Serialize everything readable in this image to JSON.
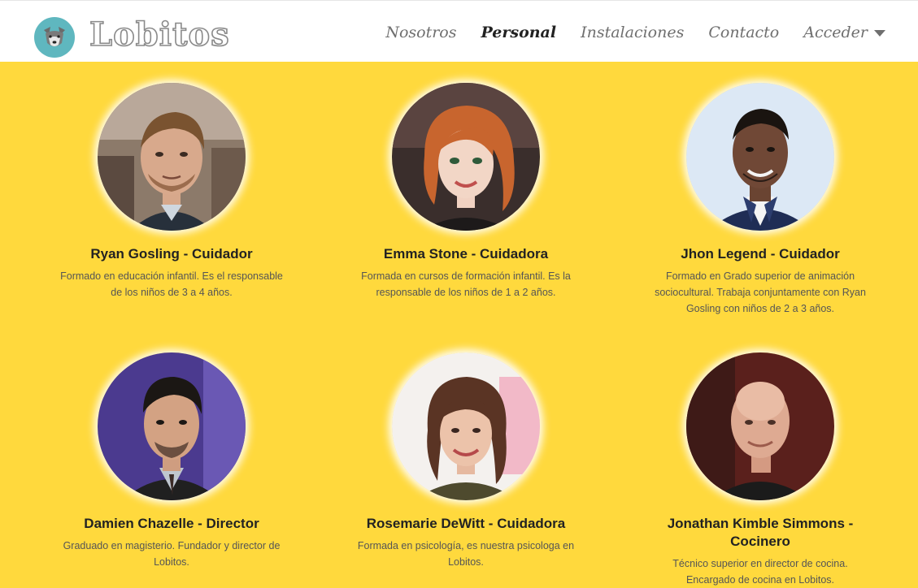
{
  "brand": {
    "name": "Lobitos",
    "logo_icon": "wolf-icon"
  },
  "nav": {
    "items": [
      {
        "label": "Nosotros",
        "active": false
      },
      {
        "label": "Personal",
        "active": true
      },
      {
        "label": "Instalaciones",
        "active": false
      },
      {
        "label": "Contacto",
        "active": false
      },
      {
        "label": "Acceder",
        "active": false,
        "dropdown": true
      }
    ]
  },
  "colors": {
    "background": "#ffd93d",
    "navbar": "#ffffff",
    "logo_circle": "#5fb7bf"
  },
  "staff": [
    {
      "name": "Ryan Gosling - Cuidador",
      "description": "Formado en educación infantil. Es el responsable de los niños de 3 a 4 años."
    },
    {
      "name": "Emma Stone - Cuidadora",
      "description": "Formada en cursos de formación infantil. Es la responsable de los niños de 1 a 2 años."
    },
    {
      "name": "Jhon Legend - Cuidador",
      "description": "Formado en Grado superior de animación sociocultural. Trabaja conjuntamente con Ryan Gosling con niños de 2 a 3 años."
    },
    {
      "name": "Damien Chazelle - Director",
      "description": "Graduado en magisterio. Fundador y director de Lobitos."
    },
    {
      "name": "Rosemarie DeWitt - Cuidadora",
      "description": "Formada en psicología, es nuestra psicologa en Lobitos."
    },
    {
      "name": "Jonathan Kimble Simmons - Cocinero",
      "description": "Técnico superior en director de cocina. Encargado de cocina en Lobitos."
    }
  ]
}
